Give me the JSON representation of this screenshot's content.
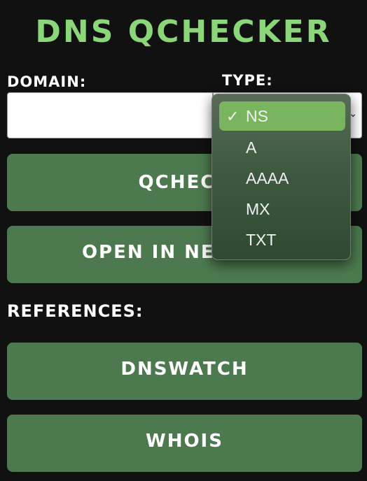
{
  "app": {
    "title": "DNS QCHECKER"
  },
  "form": {
    "domain_label": "DOMAIN:",
    "domain_value": "",
    "type_label": "TYPE:",
    "type_selected": "NS"
  },
  "buttons": {
    "qcheck": "QCHECK",
    "open_new_tab": "OPEN IN NEW TAB"
  },
  "references": {
    "label": "REFERENCES:",
    "links": [
      {
        "label": "DNSWATCH"
      },
      {
        "label": "WHOIS"
      }
    ]
  },
  "dropdown": {
    "check_mark": "✓",
    "options": [
      {
        "label": "NS",
        "selected": true
      },
      {
        "label": "A"
      },
      {
        "label": "AAAA"
      },
      {
        "label": "MX"
      },
      {
        "label": "TXT"
      }
    ]
  },
  "colors": {
    "background": "#111111",
    "title": "#8cd67a",
    "button": "#4c7a4e",
    "selected_option": "#78b55e"
  }
}
